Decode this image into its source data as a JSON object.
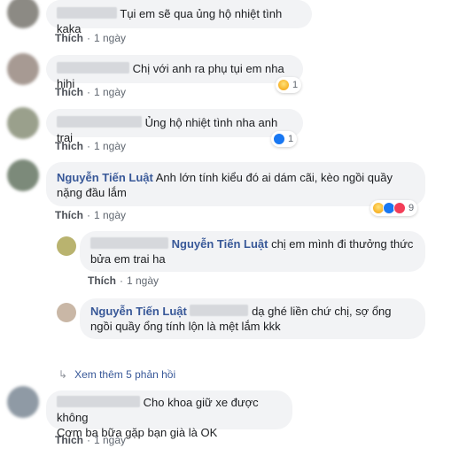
{
  "comments": [
    {
      "text": "Tụi em sẽ qua ủng hộ nhiệt tình kaka",
      "like": "Thích",
      "time": "1 ngày"
    },
    {
      "text": "Chị với anh ra phụ tụi em nha hihi",
      "like": "Thích",
      "time": "1 ngày",
      "reaction_count": "1"
    },
    {
      "text": "Ủng hộ nhiệt tình nha anh trai",
      "like": "Thích",
      "time": "1 ngày",
      "reaction_count": "1"
    },
    {
      "name": "Nguyễn Tiến Luật",
      "text_line1": "Anh lớn tính kiểu đó ai dám cãi, kèo ngồi quầy",
      "text_line2": "nặng đầu lắm",
      "like": "Thích",
      "time": "1 ngày",
      "reaction_count": "9"
    }
  ],
  "replies": [
    {
      "mention": "Nguyễn Tiến Luật",
      "text_line1": "chị em mình đi thưởng thức",
      "text_line2": "bửa em trai ha",
      "like": "Thích",
      "time": "1 ngày"
    },
    {
      "name": "Nguyễn Tiến Luật",
      "text_line1": "dạ ghé liền chứ chị, sợ ổng",
      "text_line2": "ngồi quầy ổng tính lộn là mệt lắm kkk"
    }
  ],
  "view_more": "Xem thêm 5 phản hồi",
  "last_comment": {
    "text_line1": "Cho khoa giữ xe được không",
    "text_line2": "Cơm ba bữa gặp bạn già là OK",
    "like": "Thích",
    "time": "1 ngày"
  },
  "colors": {
    "bubble": "#f2f3f5",
    "name": "#385898",
    "meta": "#606770",
    "like_blue": "#1877f2",
    "love_red": "#f33e58",
    "haha_yellow": "#f7b125"
  },
  "icons": [
    "haha-reaction-icon",
    "like-reaction-icon",
    "love-reaction-icon",
    "reply-arrow-icon"
  ]
}
